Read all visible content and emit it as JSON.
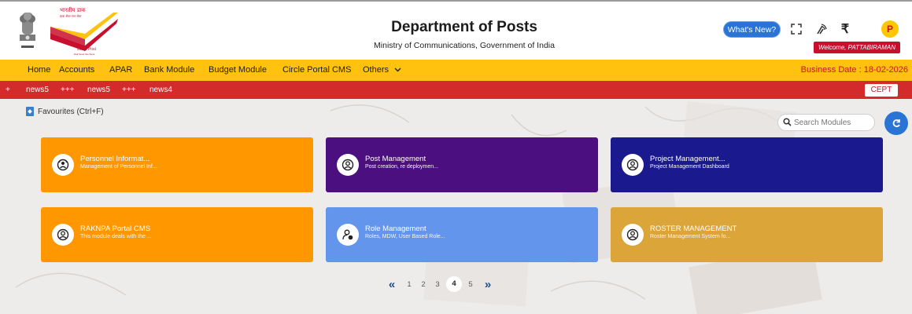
{
  "header": {
    "logo_hindi": "भारतीय डाक",
    "logo_hindi_sub": "डाक सेवा-जन सेवा",
    "logo_english": "India Post",
    "logo_english_sub": "Dak Seva Jan Seva",
    "title": "Department of Posts",
    "subtitle": "Ministry of Communications, Government of India",
    "whats_new": "What's New?",
    "rupee_symbol": "₹",
    "avatar_letter": "P",
    "welcome": "Welcome, PATTABIRAMAN"
  },
  "nav": {
    "items": [
      "Home",
      "Accounts",
      "APAR",
      "Bank Module",
      "Budget Module",
      "Circle Portal CMS",
      "Others"
    ],
    "business_date": "Business Date : 18-02-2026"
  },
  "ticker": {
    "items": [
      "+",
      "news5",
      "+++",
      "news5",
      "+++",
      "news4"
    ],
    "cept": "CEPT"
  },
  "main": {
    "favourites": "Favourites (Ctrl+F)",
    "search_placeholder": "Search Modules",
    "cards": [
      {
        "title": "Personnel Informat...",
        "desc": "Management of Personnel Inf...",
        "color": "#ff9800",
        "icon": "personnel-icon"
      },
      {
        "title": "Post Management",
        "desc": "Post creation, re deploymen...",
        "color": "#4c0f80",
        "icon": "user-circle-icon"
      },
      {
        "title": "Project Management...",
        "desc": "Project Management Dashboard",
        "color": "#1a1a8e",
        "icon": "user-circle-icon"
      },
      {
        "title": "RAKNPA Portal CMS",
        "desc": "This module deals with the ...",
        "color": "#ff9800",
        "icon": "user-circle-icon"
      },
      {
        "title": "Role Management",
        "desc": "Roles, MDW, User Based Role...",
        "color": "#6495ed",
        "icon": "user-role-icon"
      },
      {
        "title": "ROSTER MANAGEMENT",
        "desc": "Roster Management System fo...",
        "color": "#dba53a",
        "icon": "user-circle-icon"
      }
    ],
    "pagination": {
      "first": "«",
      "last": "»",
      "pages": [
        "1",
        "2",
        "3",
        "4",
        "5"
      ],
      "active": "4"
    }
  }
}
